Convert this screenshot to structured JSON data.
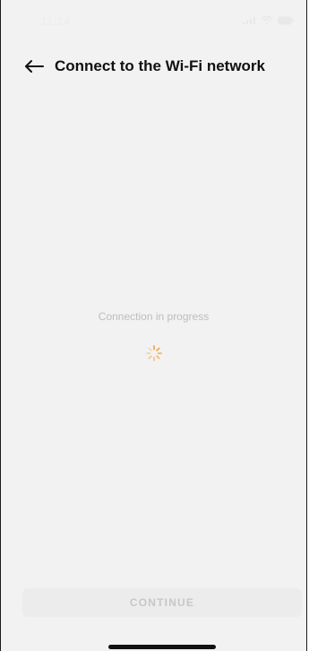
{
  "status_bar": {
    "time": "11:14",
    "icons": [
      "signal-icon",
      "wifi-icon",
      "battery-icon"
    ]
  },
  "header": {
    "back_icon": "arrow-left-icon",
    "title": "Connect to the Wi-Fi network"
  },
  "main": {
    "progress_text": "Connection in progress",
    "spinner_icon": "loading-spinner-icon"
  },
  "footer": {
    "continue_label": "CONTINUE",
    "continue_enabled": false
  },
  "colors": {
    "background": "#f2f2f2",
    "title": "#111111",
    "progress_text": "#bdbdbd",
    "spinner": "#f0a64a",
    "button_bg": "#ececec",
    "button_text": "#c7c7c7"
  }
}
